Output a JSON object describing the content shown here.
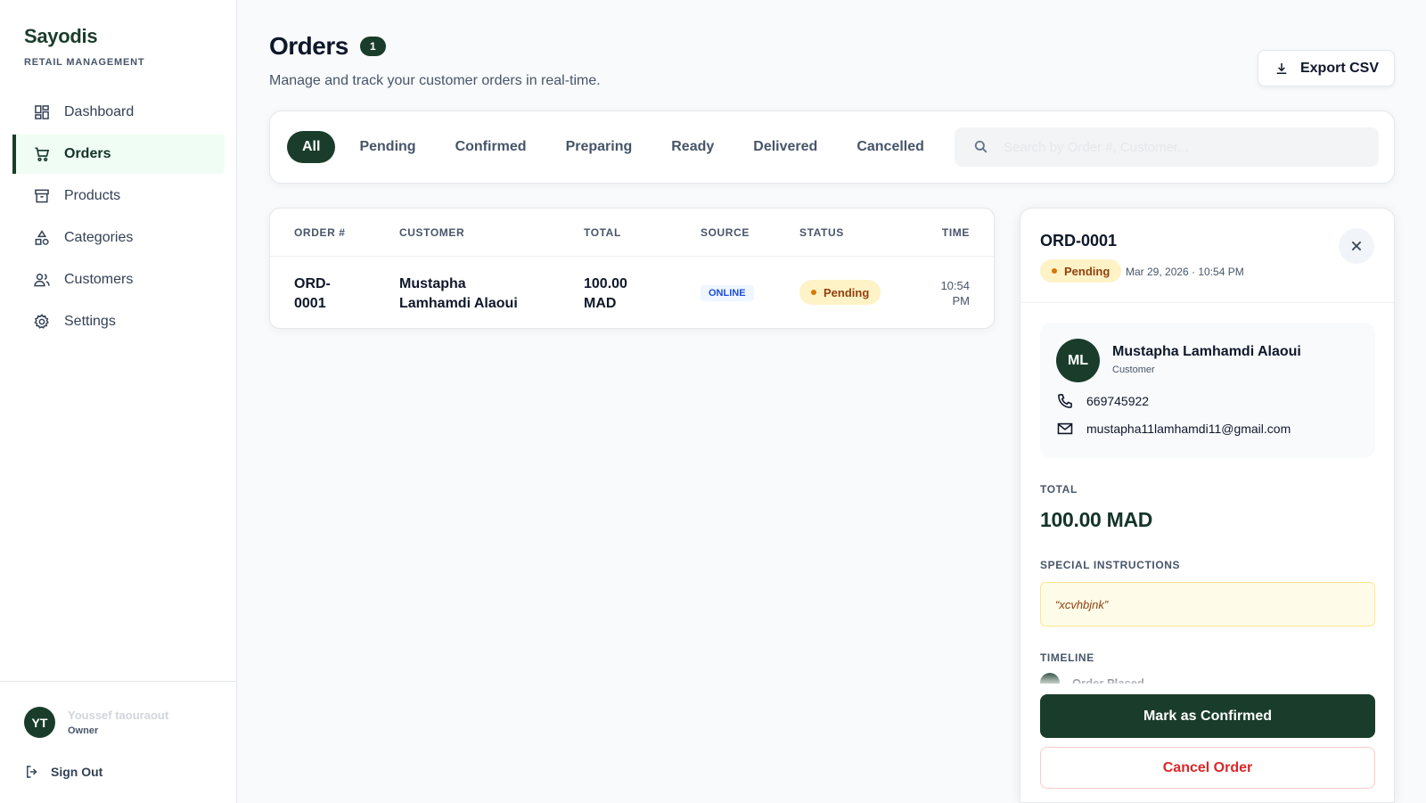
{
  "brand": {
    "name": "Sayodis",
    "subtitle": "RETAIL MANAGEMENT"
  },
  "sidebar": {
    "items": [
      {
        "label": "Dashboard",
        "icon": "dashboard-icon",
        "active": false
      },
      {
        "label": "Orders",
        "icon": "cart-icon",
        "active": true
      },
      {
        "label": "Products",
        "icon": "archive-box-icon",
        "active": false
      },
      {
        "label": "Categories",
        "icon": "shapes-icon",
        "active": false
      },
      {
        "label": "Customers",
        "icon": "users-icon",
        "active": false
      },
      {
        "label": "Settings",
        "icon": "gear-icon",
        "active": false
      }
    ]
  },
  "user": {
    "initials": "YT",
    "name": "Youssef taouraout",
    "role": "Owner",
    "signout_label": "Sign Out"
  },
  "header": {
    "title": "Orders",
    "count": "1",
    "subtitle": "Manage and track your customer orders in real-time.",
    "export_label": "Export CSV"
  },
  "filters": {
    "tabs": [
      "All",
      "Pending",
      "Confirmed",
      "Preparing",
      "Ready",
      "Delivered",
      "Cancelled"
    ],
    "active": "All",
    "search_placeholder": "Search by Order #, Customer..."
  },
  "table": {
    "columns": [
      "ORDER #",
      "CUSTOMER",
      "TOTAL",
      "SOURCE",
      "STATUS",
      "TIME"
    ],
    "rows": [
      {
        "order": "ORD-0001",
        "customer": "Mustapha Lamhamdi Alaoui",
        "total": "100.00 MAD",
        "source": "ONLINE",
        "status": "Pending",
        "time": "10:54 PM"
      }
    ]
  },
  "detail": {
    "order_id": "ORD-0001",
    "status": "Pending",
    "date": "Mar 29, 2026 · 10:54 PM",
    "customer": {
      "initials": "ML",
      "name": "Mustapha Lamhamdi Alaoui",
      "role": "Customer",
      "phone": "669745922",
      "email": "mustapha11lamhamdi11@gmail.com"
    },
    "total_label": "TOTAL",
    "total": "100.00 MAD",
    "instructions_label": "SPECIAL INSTRUCTIONS",
    "instructions": "“xcvhbjnk”",
    "timeline_label": "TIMELINE",
    "timeline_first": "Order Placed",
    "confirm_label": "Mark as Confirmed",
    "cancel_label": "Cancel Order"
  },
  "colors": {
    "brand": "#1a3d2b",
    "pending_bg": "#fef3c7",
    "pending_text": "#92400e",
    "danger": "#dc2626",
    "online_text": "#1d4ed8"
  }
}
